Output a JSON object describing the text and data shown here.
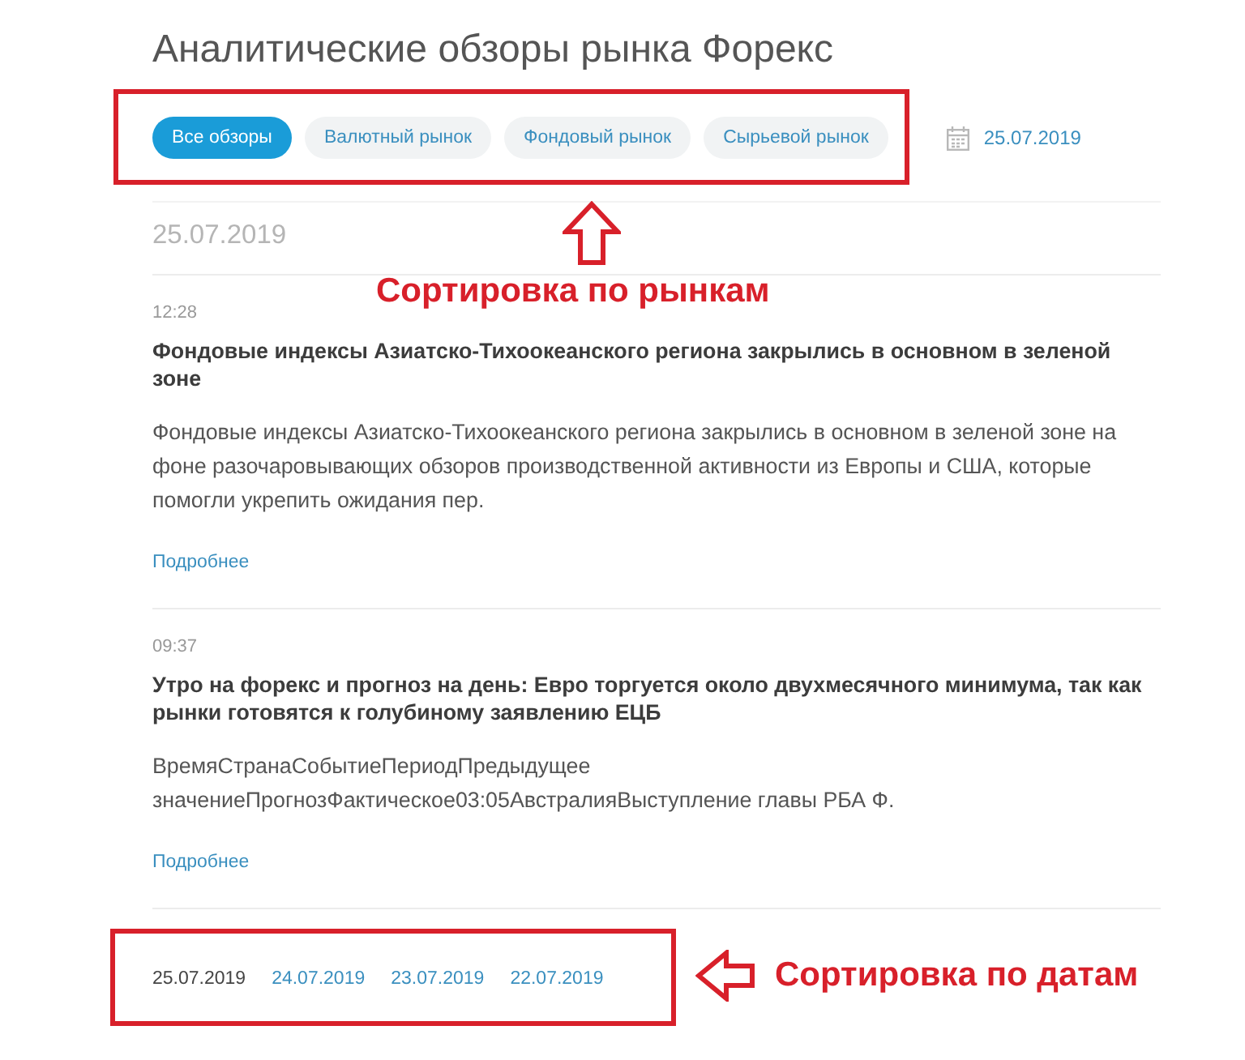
{
  "page": {
    "title": "Аналитические обзоры рынка Форекс"
  },
  "filters": [
    {
      "label": "Все обзоры",
      "selected": true
    },
    {
      "label": "Валютный рынок",
      "selected": false
    },
    {
      "label": "Фондовый рынок",
      "selected": false
    },
    {
      "label": "Сырьевой рынок",
      "selected": false
    }
  ],
  "date_picker": {
    "value": "25.07.2019"
  },
  "date_heading": "25.07.2019",
  "articles": [
    {
      "time": "12:28",
      "title": "Фондовые индексы Азиатско-Тихоокеанского региона закрылись в основном в зеленой зоне",
      "summary": "Фондовые индексы Азиатско-Тихоокеанского региона закрылись в основном в зеленой зоне на фоне разочаровывающих обзоров производственной активности из Европы и США, которые помогли укрепить ожидания пер.",
      "link": "Подробнее"
    },
    {
      "time": "09:37",
      "title": "Утро на форекс и прогноз на день: Евро торгуется около двухмесячного минимума, так как рынки готовятся к голубиному заявлению ЕЦБ",
      "summary": "ВремяСтранаСобытиеПериодПредыдущее значениеПрогнозФактическое03:05АвстралияВыступление главы РБА Ф.",
      "link": "Подробнее"
    }
  ],
  "date_pager": [
    {
      "label": "25.07.2019",
      "selected": true
    },
    {
      "label": "24.07.2019",
      "selected": false
    },
    {
      "label": "23.07.2019",
      "selected": false
    },
    {
      "label": "22.07.2019",
      "selected": false
    }
  ],
  "annotations": [
    {
      "kind": "up",
      "text": "Сортировка по рынкам"
    },
    {
      "kind": "left",
      "text": "Сортировка по датам"
    }
  ]
}
